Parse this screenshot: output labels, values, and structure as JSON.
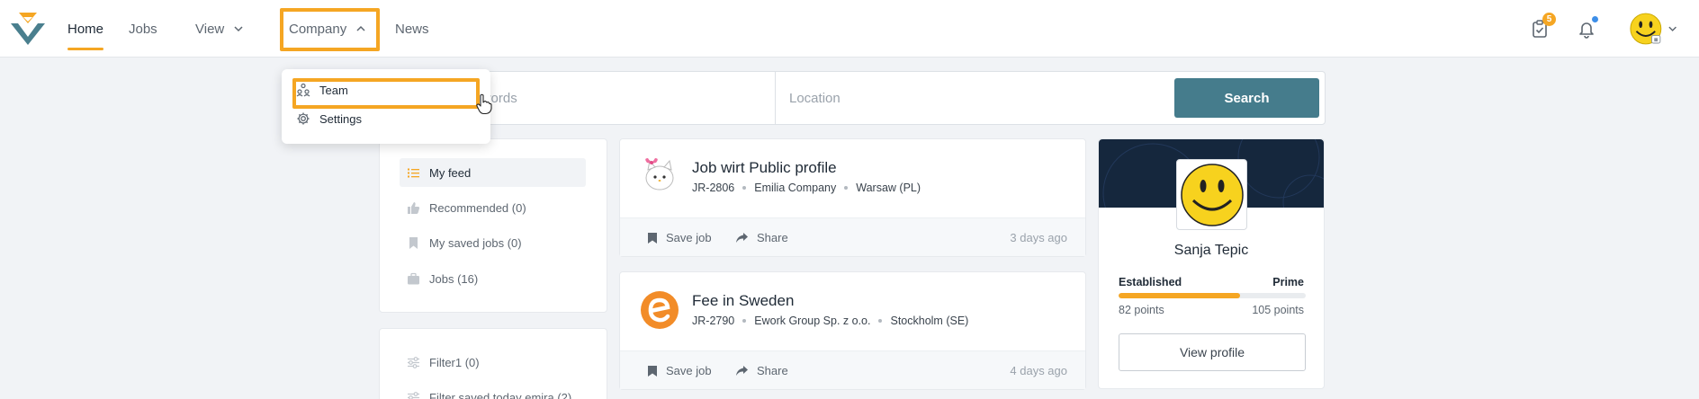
{
  "nav": {
    "home": "Home",
    "jobs": "Jobs",
    "view": "View",
    "company": "Company",
    "news": "News"
  },
  "notifications": {
    "tasks_count": "5"
  },
  "company_menu": {
    "team": "Team",
    "settings": "Settings"
  },
  "search": {
    "keywords_placeholder": "Job title or keywords",
    "location_placeholder": "Location",
    "button": "Search"
  },
  "sidebar": {
    "feed": [
      {
        "label": "My feed",
        "icon": "list-icon"
      },
      {
        "label": "Recommended (0)",
        "icon": "thumbs-up-icon"
      },
      {
        "label": "My saved jobs (0)",
        "icon": "bookmark-icon"
      },
      {
        "label": "Jobs (16)",
        "icon": "briefcase-icon"
      }
    ],
    "filters": [
      {
        "label": "Filter1 (0)",
        "icon": "sliders-icon"
      },
      {
        "label": "Filter saved today emira (2)",
        "icon": "sliders-icon"
      }
    ]
  },
  "jobs": [
    {
      "title": "Job wirt Public profile",
      "ref": "JR-2806",
      "company": "Emilia Company",
      "location": "Warsaw (PL)",
      "save": "Save job",
      "share": "Share",
      "posted": "3 days ago"
    },
    {
      "title": "Fee in Sweden",
      "ref": "JR-2790",
      "company": "Ework Group Sp. z o.o.",
      "location": "Stockholm (SE)",
      "save": "Save job",
      "share": "Share",
      "posted": "4 days ago"
    }
  ],
  "profile": {
    "name": "Sanja Tepic",
    "level_current": "Established",
    "level_next": "Prime",
    "progress_fraction": 0.65,
    "points_current": "82 points",
    "points_next": "105 points",
    "button": "View profile"
  },
  "colors": {
    "accent": "#f5a623",
    "primary_button": "#457c8c",
    "banner": "#15273d",
    "notification_dot": "#3d8ee8"
  }
}
